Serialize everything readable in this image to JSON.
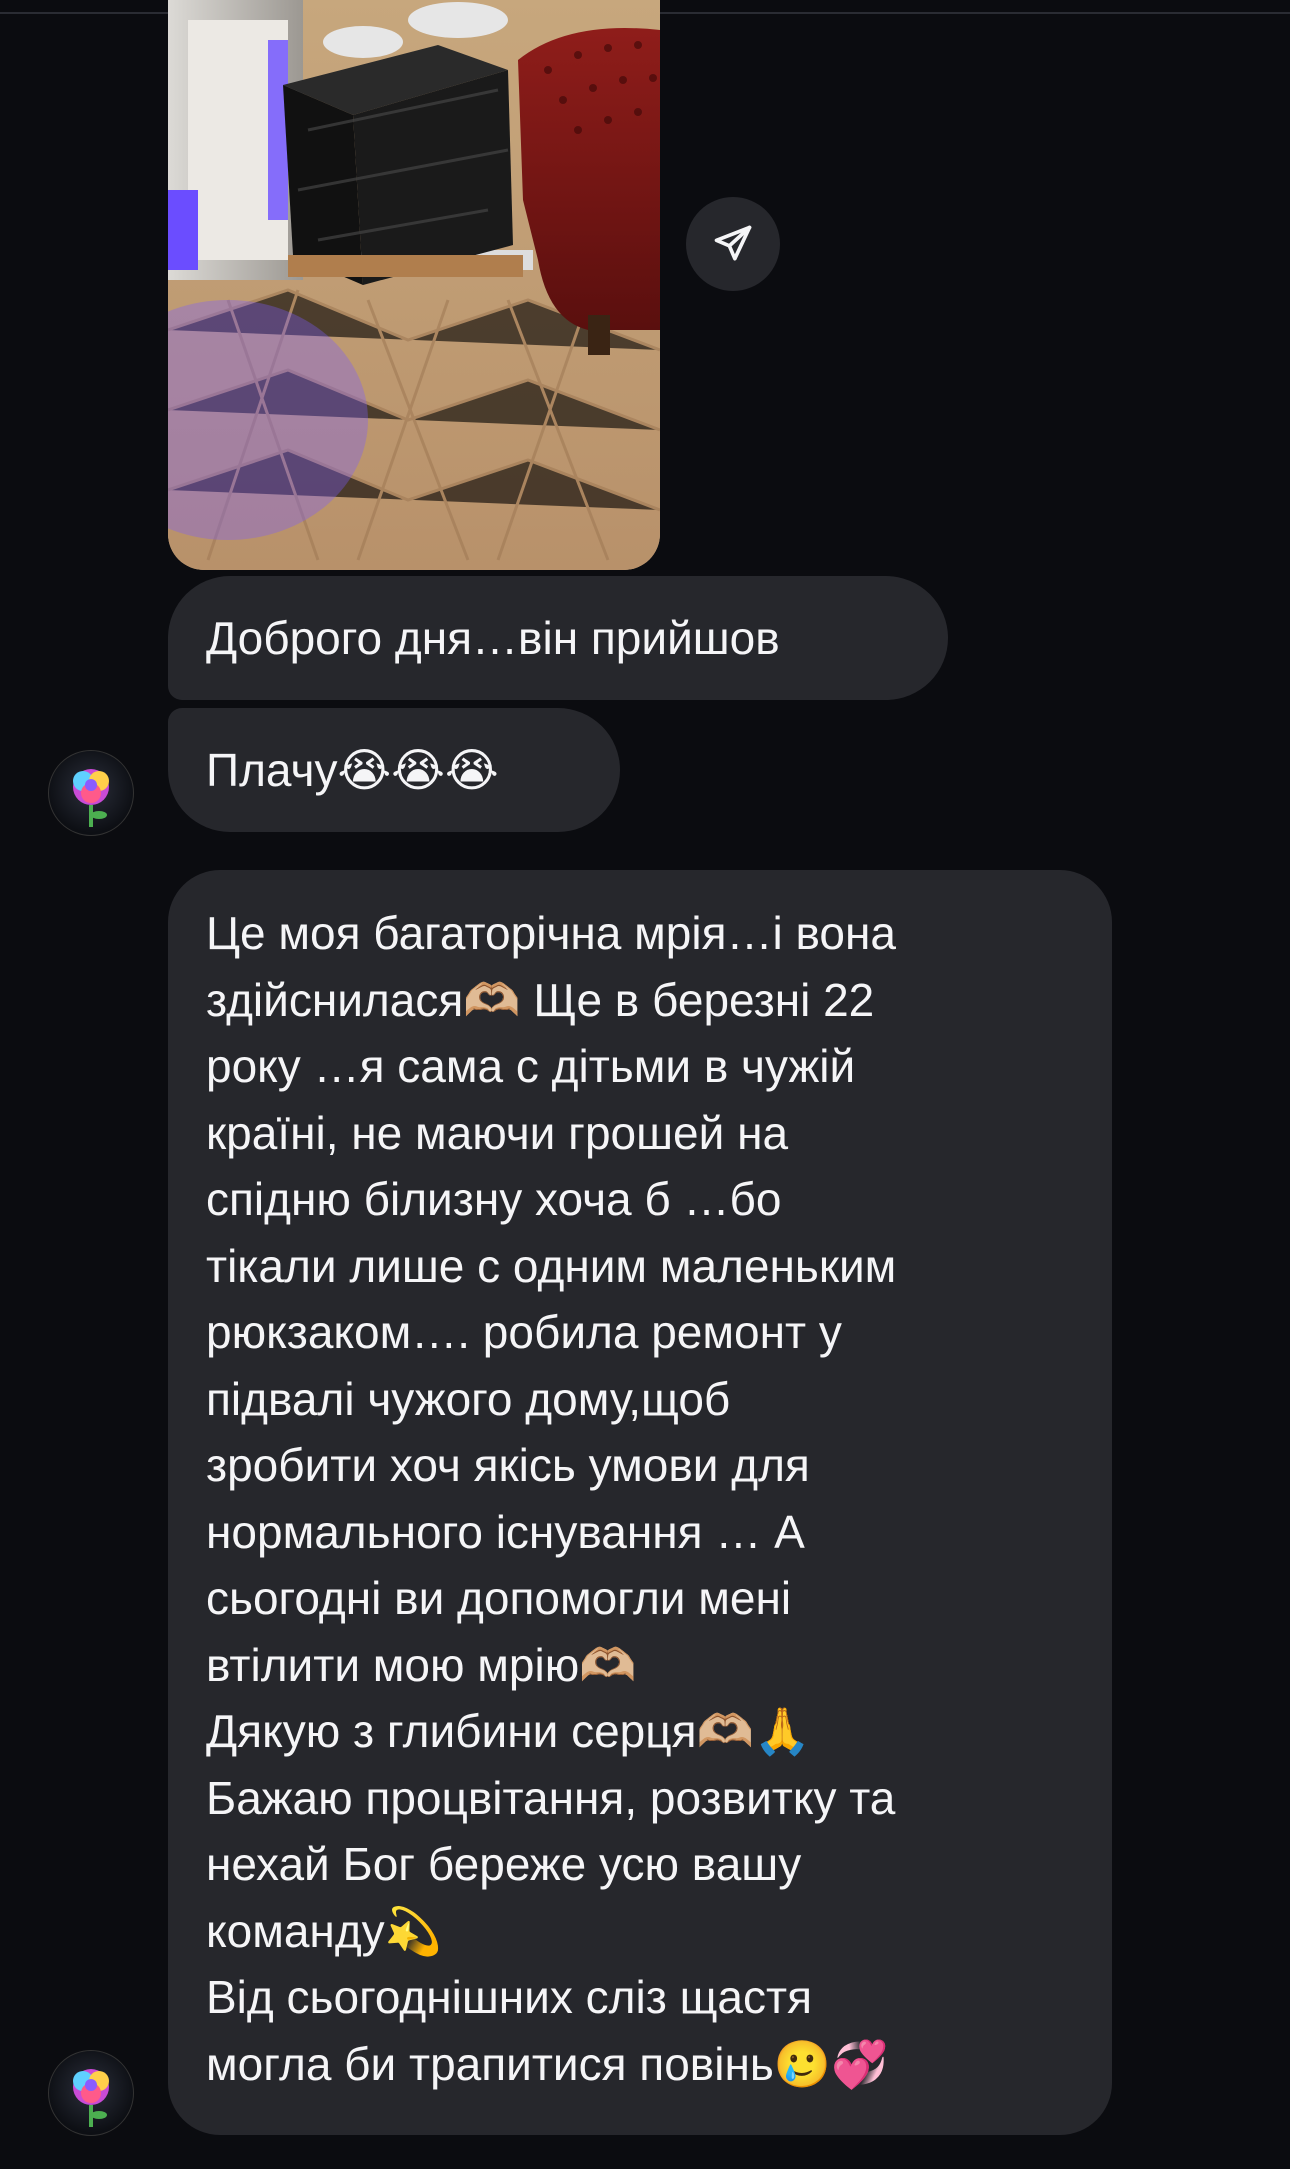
{
  "messages": {
    "msg1": "Доброго дня…він прийшов",
    "msg2": "Плачу😭😭😭",
    "msg3_lines": [
      "Це моя багаторічна мрія…і вона",
      "здійснилася🫶🏼 Ще в березні 22",
      "року …я сама с дітьми в чужій",
      "країні, не маючи грошей на",
      "спідню білизну хоча б …бо",
      "тікали лише с одним маленьким",
      "рюкзаком…. робила ремонт у",
      "підвалі чужого дому,щоб",
      "зробити хоч якісь умови для",
      "нормального існування … А",
      "сьогодні ви допомогли мені",
      "втілити мою мрію🫶🏼",
      "Дякую з глибини серця🫶🏼🙏",
      "Бажаю процвітання, розвитку та",
      "нехай Бог береже усю вашу",
      "команду💫",
      "Від сьогоднішних сліз щастя",
      "могла би трапитися повінь🥲💞"
    ]
  },
  "icons": {
    "share": "paper-plane-icon",
    "avatar": "rose-avatar"
  },
  "colors": {
    "background": "#0b0c10",
    "bubble": "#26272c",
    "text": "#f5f5f7"
  }
}
